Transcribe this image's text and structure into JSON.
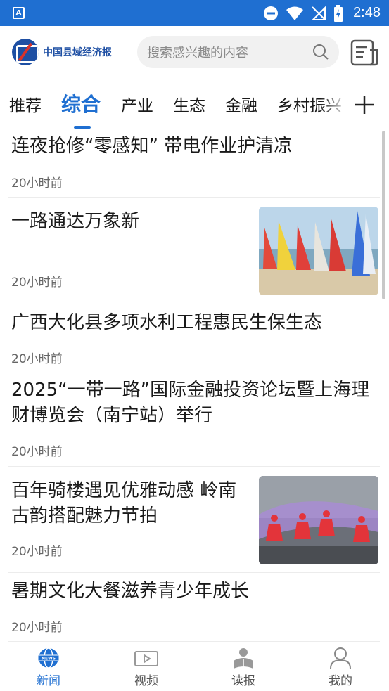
{
  "status_bar": {
    "time": "2:48",
    "app_badge": "A"
  },
  "header": {
    "logo_text": "中国县域经济报",
    "search_placeholder": "搜索感兴趣的内容"
  },
  "tabs": [
    {
      "label": "推荐",
      "active": false
    },
    {
      "label": "综合",
      "active": true
    },
    {
      "label": "产业",
      "active": false
    },
    {
      "label": "生态",
      "active": false
    },
    {
      "label": "金融",
      "active": false
    },
    {
      "label": "乡村振兴",
      "active": false
    }
  ],
  "articles": [
    {
      "title": "连夜抢修“零感知” 带电作业护清凉",
      "time": "20小时前"
    },
    {
      "title": "一路通达万象新",
      "time": "20小时前"
    },
    {
      "title": "广西大化县多项水利工程惠民生保生态",
      "time": "20小时前"
    },
    {
      "title": "2025“一带一路”国际金融投资论坛暨上海理财博览会（南宁站）举行",
      "time": "20小时前"
    },
    {
      "title": "百年骑楼遇见优雅动感 岭南古韵搭配魅力节拍",
      "time": "20小时前"
    },
    {
      "title": "暑期文化大餐滋养青少年成长",
      "time": "20小时前"
    }
  ],
  "bottom_nav": [
    {
      "label": "新闻",
      "active": true,
      "icon": "globe-news-icon",
      "badge": "NEWS"
    },
    {
      "label": "视频",
      "active": false,
      "icon": "video-icon"
    },
    {
      "label": "读报",
      "active": false,
      "icon": "reader-icon"
    },
    {
      "label": "我的",
      "active": false,
      "icon": "profile-icon"
    }
  ],
  "colors": {
    "accent": "#1f6fd1",
    "status_bar": "#1f6fd1",
    "text": "#1a1a1a",
    "muted": "#666666"
  }
}
